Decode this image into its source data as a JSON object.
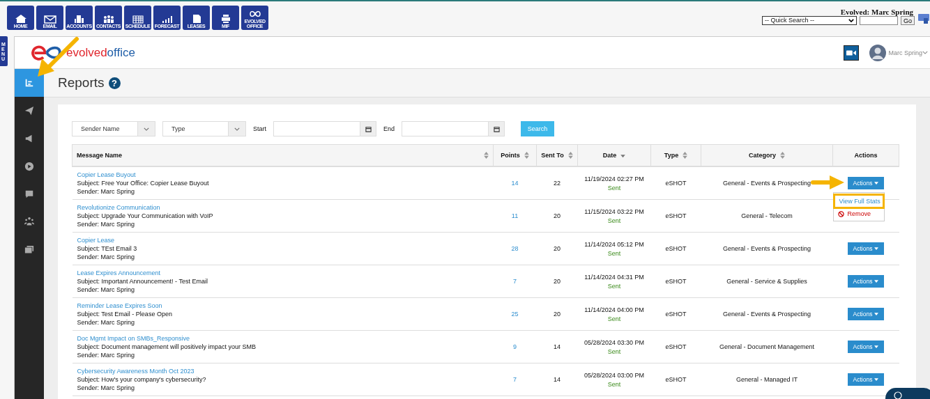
{
  "toolbar": {
    "items": [
      {
        "label": "HOME"
      },
      {
        "label": "EMAIL"
      },
      {
        "label": "ACCOUNTS"
      },
      {
        "label": "CONTACTS"
      },
      {
        "label": "SCHEDULE"
      },
      {
        "label": "FORECAST"
      },
      {
        "label": "LEASES"
      },
      {
        "label": "MIF"
      },
      {
        "label": "EVOLVED OFFICE"
      }
    ],
    "user_title": "Evolved: Marc Spring",
    "quick_search": "-- Quick Search --",
    "go": "Go"
  },
  "menu_tab": "MENU",
  "logo": {
    "part_1": "evolved",
    "part_2": "office"
  },
  "user": {
    "name": "Marc Spring"
  },
  "sidebar": {
    "items": [
      {
        "selected": true
      },
      {
        "selected": false
      },
      {
        "selected": false
      },
      {
        "selected": false
      },
      {
        "selected": false
      },
      {
        "selected": false
      },
      {
        "selected": false
      }
    ]
  },
  "page_title": "Reports",
  "help_icon": "?",
  "filters": {
    "sender": "Sender Name",
    "type": "Type",
    "start_label": "Start",
    "end_label": "End",
    "search": "Search"
  },
  "table": {
    "columns": [
      {
        "label": "Message Name",
        "sortable": true
      },
      {
        "label": "Points",
        "sortable": true
      },
      {
        "label": "Sent To",
        "sortable": true
      },
      {
        "label": "Date",
        "sortable": true,
        "sorted": true
      },
      {
        "label": "Type",
        "sortable": true
      },
      {
        "label": "Category",
        "sortable": true
      },
      {
        "label": "Actions",
        "sortable": false
      }
    ],
    "rows": [
      {
        "name": "Copier Lease Buyout",
        "subject": "Subject: Free Your Office: Copier Lease Buyout",
        "sender": "Sender: Marc Spring",
        "points": "14",
        "sent_to": "22",
        "date": "11/19/2024 02:27 PM",
        "status": "Sent",
        "type": "eSHOT",
        "category": "General - Events & Prospecting",
        "actions": "Actions",
        "menu": [
          {
            "label": "View Full Stats",
            "kind": "link",
            "highlighted": true
          },
          {
            "label": "Remove",
            "kind": "danger",
            "highlighted": false
          }
        ]
      },
      {
        "name": "Revolutionize Communication",
        "subject": "Subject: Upgrade Your Communication with VoIP",
        "sender": "Sender: Marc Spring",
        "points": "11",
        "sent_to": "20",
        "date": "11/15/2024 03:22 PM",
        "status": "Sent",
        "type": "eSHOT",
        "category": "General - Telecom"
      },
      {
        "name": "Copier Lease",
        "subject": "Subject: TEst Email 3",
        "sender": "Sender: Marc Spring",
        "points": "28",
        "sent_to": "20",
        "date": "11/14/2024 05:12 PM",
        "status": "Sent",
        "type": "eSHOT",
        "category": "General - Events & Prospecting",
        "actions": "Actions"
      },
      {
        "name": "Lease Expires Announcement",
        "subject": "Subject: Important Announcement! - Test Email",
        "sender": "Sender: Marc Spring",
        "points": "7",
        "sent_to": "20",
        "date": "11/14/2024 04:31 PM",
        "status": "Sent",
        "type": "eSHOT",
        "category": "General - Service & Supplies",
        "actions": "Actions"
      },
      {
        "name": "Reminder Lease Expires Soon",
        "subject": "Subject: Test Email - Please Open",
        "sender": "Sender: Marc Spring",
        "points": "25",
        "sent_to": "20",
        "date": "11/14/2024 04:00 PM",
        "status": "Sent",
        "type": "eSHOT",
        "category": "General - Events & Prospecting",
        "actions": "Actions"
      },
      {
        "name": "Doc Mgmt Impact on SMBs_Responsive",
        "subject": "Subject: Document management will positively impact your SMB",
        "sender": "Sender: Marc Spring",
        "points": "9",
        "sent_to": "14",
        "date": "05/28/2024 03:30 PM",
        "status": "Sent",
        "type": "eSHOT",
        "category": "General - Document Management",
        "actions": "Actions"
      },
      {
        "name": "Cybersecurity Awareness Month Oct 2023",
        "subject": "Subject: How's your company's cybersecurity?",
        "sender": "Sender: Marc Spring",
        "points": "7",
        "sent_to": "14",
        "date": "05/28/2024 03:00 PM",
        "status": "Sent",
        "type": "eSHOT",
        "category": "General - Managed IT",
        "actions": "Actions"
      }
    ]
  }
}
